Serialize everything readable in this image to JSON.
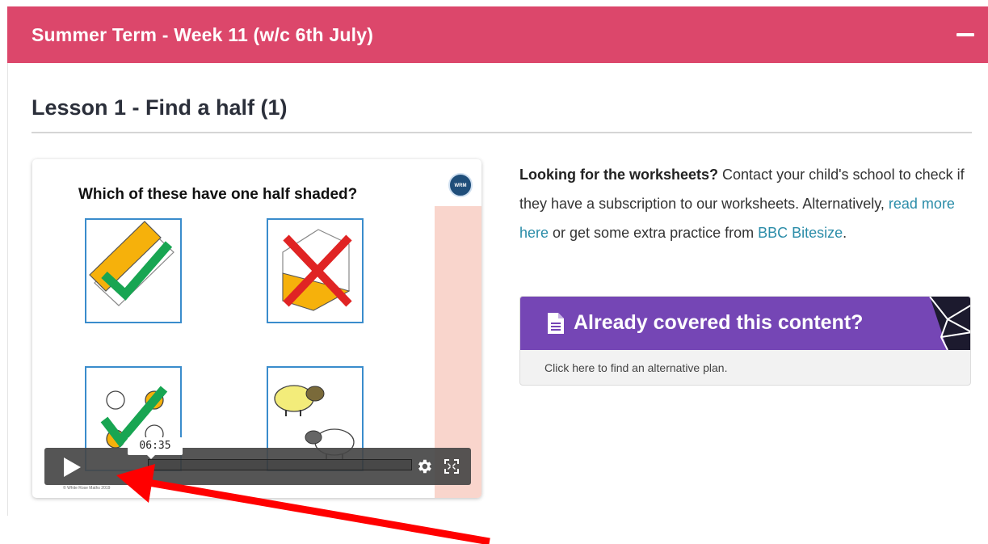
{
  "panel": {
    "title": "Summer Term - Week 11 (w/c 6th July)",
    "collapse_icon": "minus-icon",
    "color": "#dc476b"
  },
  "lesson": {
    "title": "Lesson 1 - Find a half (1)"
  },
  "video": {
    "question": "Which of these have one half shaded?",
    "logo_text": "White Rose Maths",
    "copyright": "© White Rose Maths 2019",
    "time_tooltip": "06:35",
    "play_icon": "play-icon",
    "settings_icon": "gear-icon",
    "fullscreen_icon": "fullscreen-icon"
  },
  "info": {
    "bold_lead": "Looking for the worksheets?",
    "text_1": " Contact your child's school to check if they have a subscription to our worksheets. Alternatively, ",
    "link_1": "read more here",
    "text_2": " or get some extra practice from ",
    "link_2": "BBC Bitesize",
    "text_3": "."
  },
  "alt_plan": {
    "title": "Already covered this content?",
    "subtitle": "Click here to find an alternative plan.",
    "icon": "document-icon",
    "color": "#7546b5"
  },
  "annotation": {
    "arrow_color": "#ff0000"
  }
}
